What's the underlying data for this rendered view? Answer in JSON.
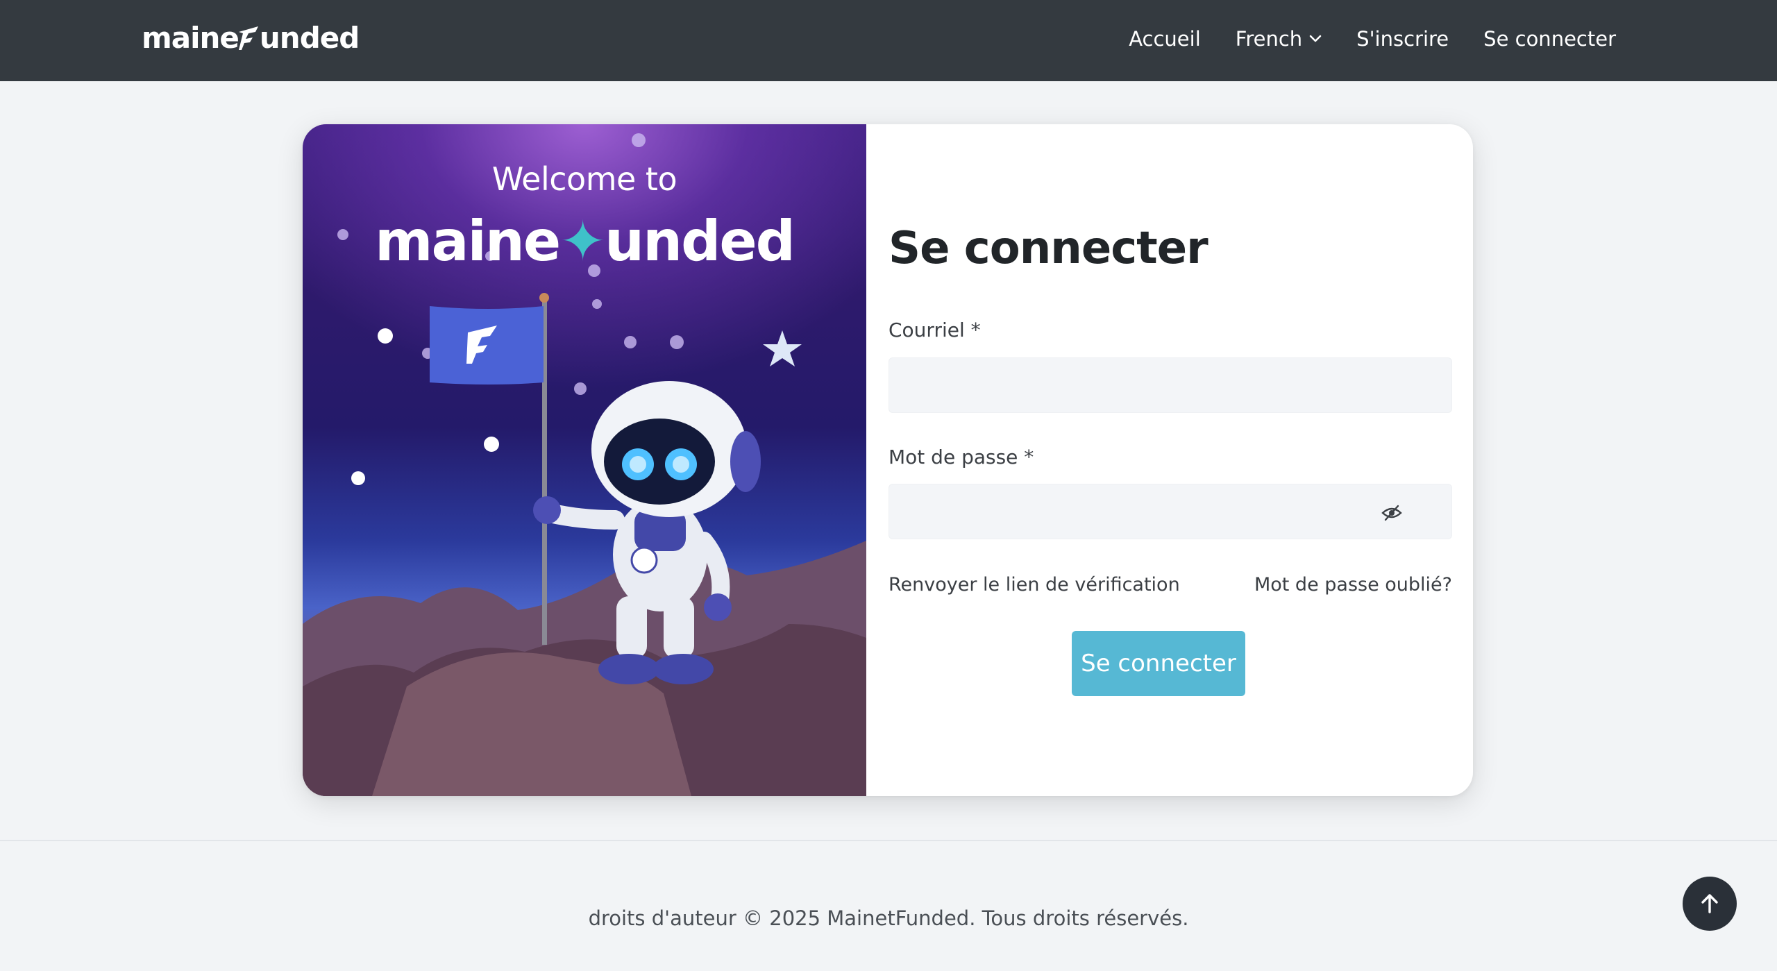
{
  "navbar": {
    "brand_pre": "maine",
    "brand_post": "unded",
    "links": {
      "home": "Accueil",
      "language": "French",
      "register": "S'inscrire",
      "login": "Se connecter"
    }
  },
  "hero": {
    "welcome": "Welcome to",
    "brand_pre": "maine",
    "brand_post": "unded"
  },
  "form": {
    "title": "Se connecter",
    "email_label": "Courriel *",
    "email_value": "",
    "password_label": "Mot de passe *",
    "password_value": "",
    "resend_link": "Renvoyer le lien de vérification",
    "forgot_link": "Mot de passe oublié?",
    "submit_label": "Se connecter"
  },
  "footer": {
    "copyright": "droits d'auteur © 2025 MainetFunded. Tous droits réservés."
  },
  "colors": {
    "navbar_bg": "#343a40",
    "page_bg": "#f2f4f6",
    "submit_bg": "#56b8d4",
    "brand_accent": "#3fc1c9",
    "to_top_bg": "#2a3038"
  },
  "icons": {
    "language_dropdown": "chevron-down-icon",
    "password_toggle": "eye-slash-icon",
    "back_to_top": "arrow-up-icon",
    "brand_mark": "f-logo-icon"
  }
}
